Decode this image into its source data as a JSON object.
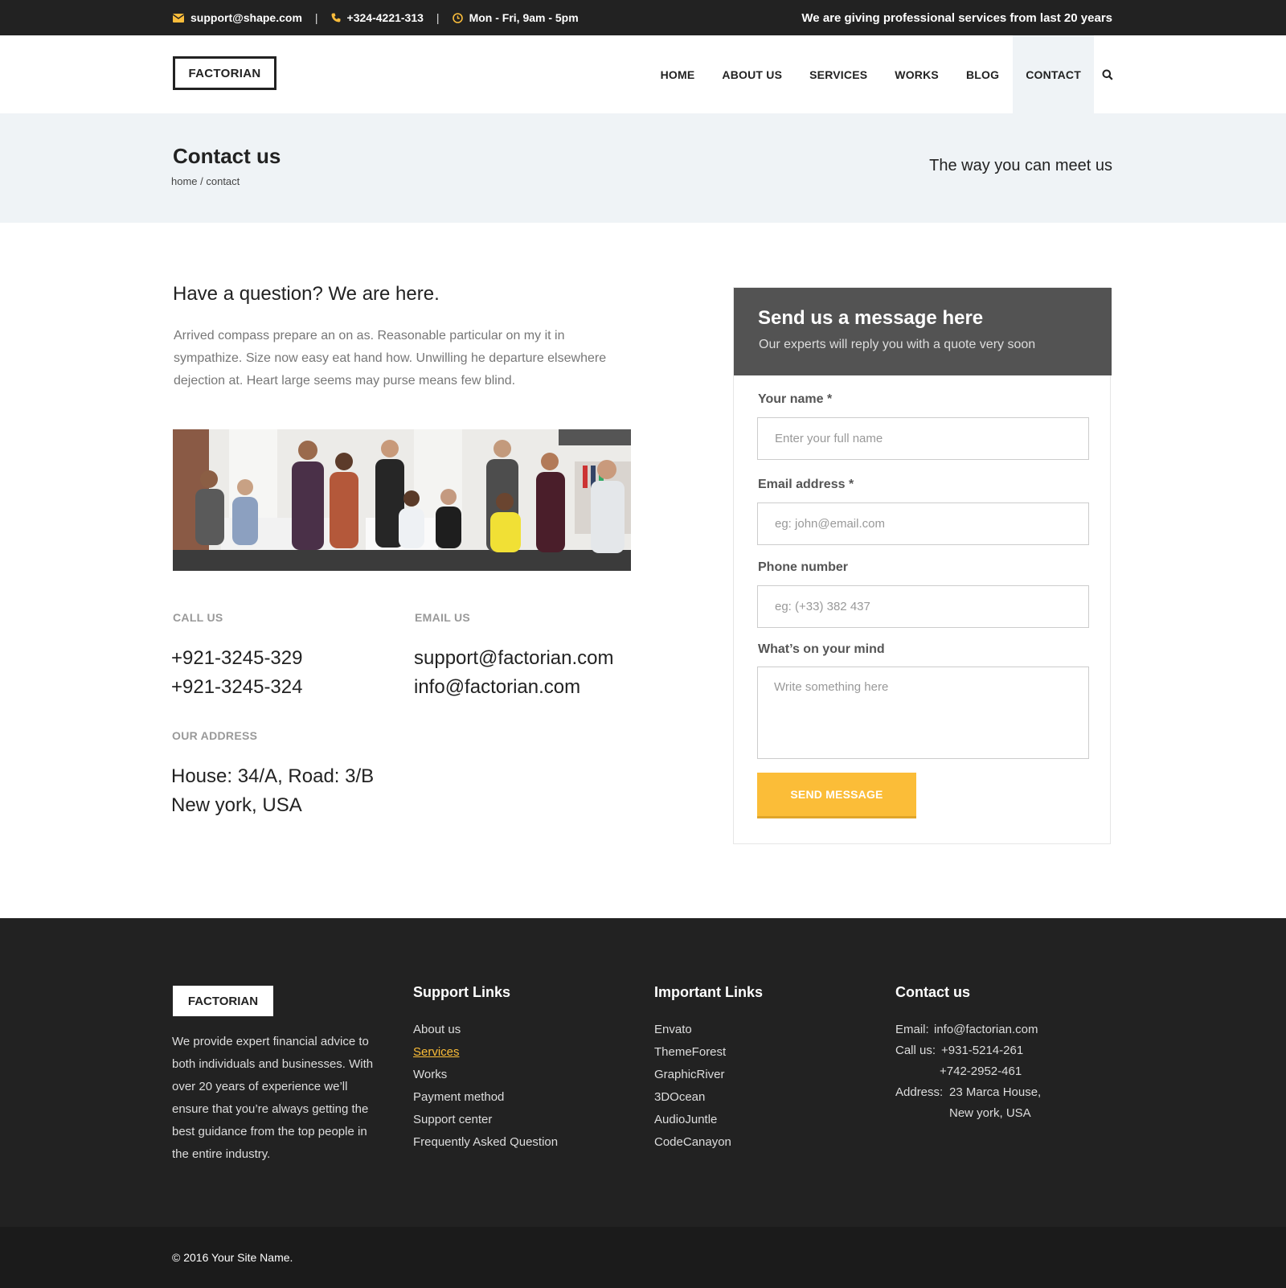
{
  "topbar": {
    "email": "support@shape.com",
    "phone": "+324-4221-313",
    "hours": "Mon - Fri, 9am - 5pm",
    "separator": "|",
    "tagline": "We are giving professional services from last 20 years",
    "accent": "#f9bc3b"
  },
  "header": {
    "logo": "FACTORIAN",
    "nav": [
      "HOME",
      "ABOUT US",
      "SERVICES",
      "WORKS",
      "BLOG",
      "CONTACT"
    ],
    "active": "CONTACT",
    "search_icon": "search-icon"
  },
  "banner": {
    "title": "Contact us",
    "breadcrumb": "home / contact",
    "tagline": "The way you can meet us"
  },
  "intro": {
    "title": "Have a question? We are here.",
    "text": "Arrived compass prepare an on as. Reasonable particular on my it in sympathize. Size now easy eat hand how. Unwilling he departure elsewhere dejection at. Heart large seems may purse means few blind."
  },
  "contact": {
    "call_label": "CALL US",
    "phones": [
      "+921-3245-329",
      "+921-3245-324"
    ],
    "email_label": "EMAIL US",
    "emails": [
      "support@factorian.com",
      "info@factorian.com"
    ],
    "address_label": "OUR ADDRESS",
    "address": [
      "House: 34/A, Road: 3/B",
      "New york, USA"
    ]
  },
  "form": {
    "title": "Send us a message here",
    "subtitle": "Our experts will reply you with a quote very soon",
    "name_label": "Your name *",
    "name_placeholder": "Enter your full name",
    "email_label": "Email address *",
    "email_placeholder": "eg: john@email.com",
    "phone_label": "Phone number",
    "phone_placeholder": "eg: (+33) 382 437",
    "message_label": "What’s on your mind",
    "message_placeholder": "Write something here",
    "submit": "SEND MESSAGE",
    "button_color": "#fbbd38"
  },
  "footer": {
    "logo": "FACTORIAN",
    "about": "We provide expert financial advice to both individuals and businesses. With over 20 years of experience we’ll ensure that you’re always getting the best guidance from the top people in the entire industry.",
    "support_title": "Support Links",
    "support_links": [
      "About us",
      "Services",
      "Works",
      "Payment method",
      "Support center",
      "Frequently Asked Question"
    ],
    "important_title": "Important Links",
    "important_links": [
      "Envato",
      "ThemeForest",
      "GraphicRiver",
      "3DOcean",
      "AudioJuntle",
      "CodeCanayon"
    ],
    "contact_title": "Contact us",
    "email_key": "Email:",
    "email_val": "info@factorian.com",
    "call_key": "Call us:",
    "call_vals": [
      "+931-5214-261",
      "+742-2952-461"
    ],
    "address_key": "Address:",
    "address_vals": [
      "23 Marca House,",
      "New york, USA"
    ],
    "copyright": "© 2016 Your Site Name."
  }
}
